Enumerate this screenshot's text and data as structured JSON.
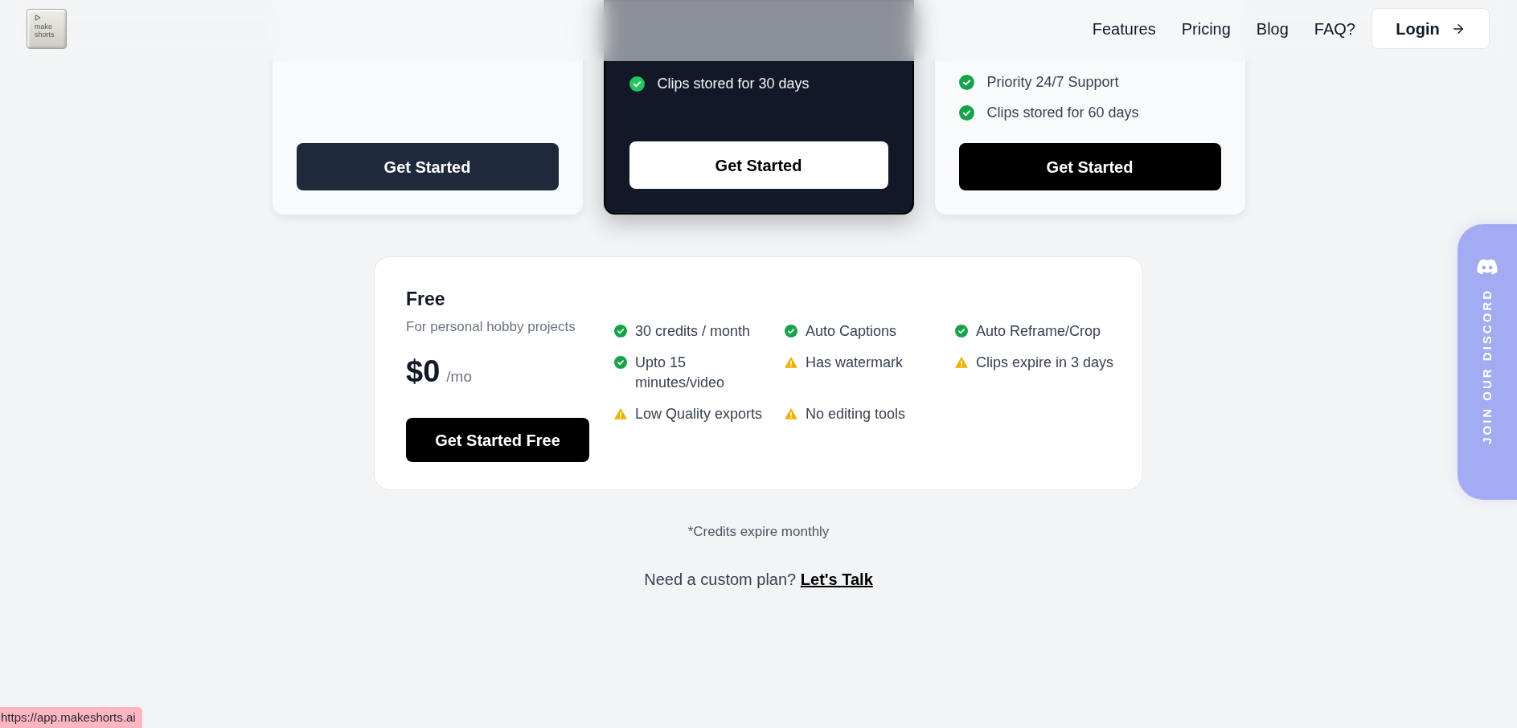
{
  "header": {
    "logo": {
      "text": "make shorts"
    },
    "nav": [
      {
        "label": "Features"
      },
      {
        "label": "Pricing"
      },
      {
        "label": "Blog"
      },
      {
        "label": "FAQ?"
      }
    ],
    "login_button": {
      "label": "Login"
    }
  },
  "plans": [
    {
      "kind": "slate",
      "button": "Get Started"
    },
    {
      "kind": "dark",
      "features": [
        {
          "kind": "check",
          "text": "Clips stored for 30 days"
        }
      ],
      "button": "Get Started"
    },
    {
      "kind": "black",
      "features": [
        {
          "kind": "check",
          "text": "Priority 24/7 Support"
        },
        {
          "kind": "check",
          "text": "Clips stored for 60 days"
        }
      ],
      "button": "Get Started"
    }
  ],
  "free_plan": {
    "title": "Free",
    "description": "For personal hobby projects",
    "price": "$0",
    "period": "/mo",
    "button": "Get Started Free",
    "features": [
      {
        "kind": "check",
        "text": "30 credits / month"
      },
      {
        "kind": "check",
        "text": "Auto Captions"
      },
      {
        "kind": "check",
        "text": "Auto Reframe/Crop"
      },
      {
        "kind": "check",
        "text": "Upto 15 minutes/video"
      },
      {
        "kind": "warning",
        "text": "Has watermark"
      },
      {
        "kind": "warning",
        "text": "Clips expire in 3 days"
      },
      {
        "kind": "warning",
        "text": "Low Quality exports"
      },
      {
        "kind": "warning",
        "text": "No editing tools"
      }
    ]
  },
  "notes": {
    "credits_note": "*Credits expire monthly",
    "custom_plan": {
      "text": "Need a custom plan?",
      "link": "Let's Talk"
    }
  },
  "discord_tab": {
    "label": "JOIN OUR DISCORD"
  },
  "status_bar": {
    "url": "https://app.makeshorts.ai"
  }
}
